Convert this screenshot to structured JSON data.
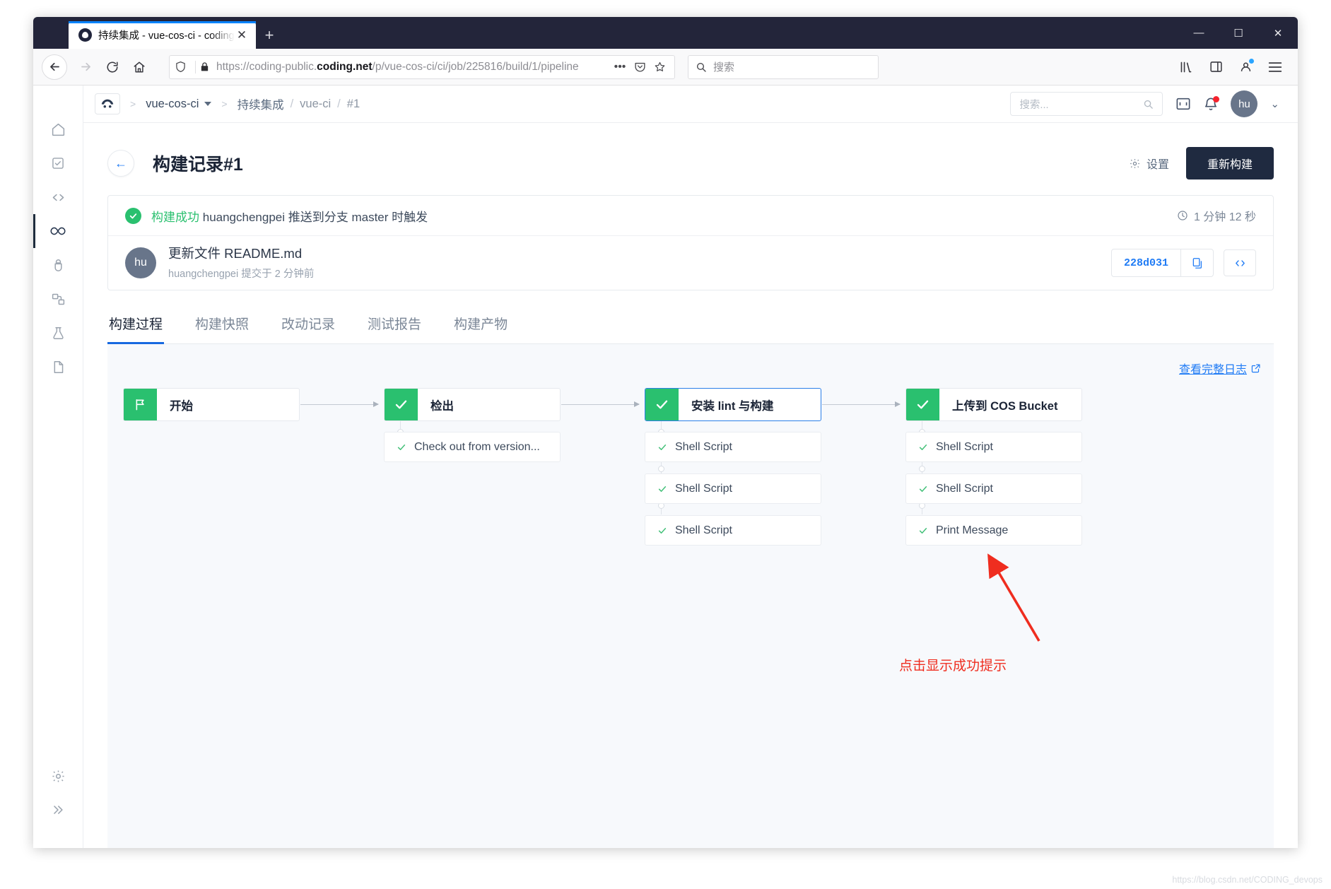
{
  "browser": {
    "tab": {
      "title": "持续集成 - vue-cos-ci - coding",
      "close_label": "✕",
      "favicon": "coding-logo-icon"
    },
    "newtab_label": "+",
    "window": {
      "minimize": "―",
      "maximize": "☐",
      "close": "✕"
    },
    "nav": {
      "back": "←",
      "forward": "→",
      "reload": "⟳",
      "home": "⌂",
      "url_prefix": "https://coding-public.",
      "url_domain": "coding.net",
      "url_suffix": "/p/vue-cos-ci/ci/job/225816/build/1/pipeline",
      "more_label": "•••"
    },
    "search": {
      "placeholder": "搜索"
    }
  },
  "app": {
    "rail": [
      {
        "name": "home",
        "glyph": "home-icon"
      },
      {
        "name": "tasks",
        "glyph": "check-square-icon"
      },
      {
        "name": "code",
        "glyph": "code-icon"
      },
      {
        "name": "ci",
        "glyph": "infinity-icon",
        "active": true
      },
      {
        "name": "artifacts",
        "glyph": "bug-icon"
      },
      {
        "name": "deploy",
        "glyph": "layers-icon"
      },
      {
        "name": "testing",
        "glyph": "flask-icon"
      },
      {
        "name": "docs",
        "glyph": "file-icon"
      }
    ],
    "rail_bottom": [
      {
        "name": "settings",
        "glyph": "gear-icon"
      },
      {
        "name": "expand",
        "glyph": "chevron-double-right-icon"
      }
    ],
    "breadcrumb": {
      "project": "vue-cos-ci",
      "section": "持续集成",
      "job": "vue-ci",
      "build": "#1",
      "separator": ">",
      "slash": "/"
    },
    "header": {
      "search_placeholder": "搜索...",
      "panel_icon": "panel-icon",
      "bell_icon": "bell-icon",
      "avatar_initials": "hu",
      "chevron": "⌄"
    }
  },
  "page": {
    "back_arrow": "←",
    "title_main": "构建记录",
    "title_num": "#1",
    "settings_label": "设置",
    "rebuild_label": "重新构建",
    "status": {
      "badge": "✓",
      "result": "构建成功",
      "detail": "huangchengpei 推送到分支 master 时触发",
      "duration": "1 分钟 12 秒",
      "duration_icon": "clock-icon"
    },
    "commit": {
      "avatar_initials": "hu",
      "message": "更新文件 README.md",
      "meta": "huangchengpei 提交于 2 分钟前",
      "sha": "228d031",
      "copy_icon": "copy-icon",
      "code_icon": "</>"
    },
    "tabs": [
      {
        "label": "构建过程",
        "active": true
      },
      {
        "label": "构建快照",
        "active": false
      },
      {
        "label": "改动记录",
        "active": false
      },
      {
        "label": "测试报告",
        "active": false
      },
      {
        "label": "构建产物",
        "active": false
      }
    ],
    "full_log_link": "查看完整日志",
    "full_log_icon": "external-link-icon",
    "annotation": "点击显示成功提示",
    "watermark": "https://blog.csdn.net/CODING_devops",
    "colors": {
      "success": "#2ac06f",
      "accent": "#1f7bf5",
      "annotation": "#ef2d1f",
      "dark": "#1f2a40"
    }
  },
  "pipeline": {
    "stages": [
      {
        "name": "开始",
        "icon": "flag-icon",
        "selected": false,
        "steps": []
      },
      {
        "name": "检出",
        "icon": "check-icon",
        "selected": false,
        "steps": [
          {
            "label": "Check out from version...",
            "status": "success"
          }
        ]
      },
      {
        "name": "安装 lint 与构建",
        "icon": "check-icon",
        "selected": true,
        "steps": [
          {
            "label": "Shell Script",
            "status": "success"
          },
          {
            "label": "Shell Script",
            "status": "success"
          },
          {
            "label": "Shell Script",
            "status": "success"
          }
        ]
      },
      {
        "name": "上传到 COS Bucket",
        "icon": "check-icon",
        "selected": false,
        "steps": [
          {
            "label": "Shell Script",
            "status": "success"
          },
          {
            "label": "Shell Script",
            "status": "success"
          },
          {
            "label": "Print Message",
            "status": "success"
          }
        ]
      }
    ]
  }
}
